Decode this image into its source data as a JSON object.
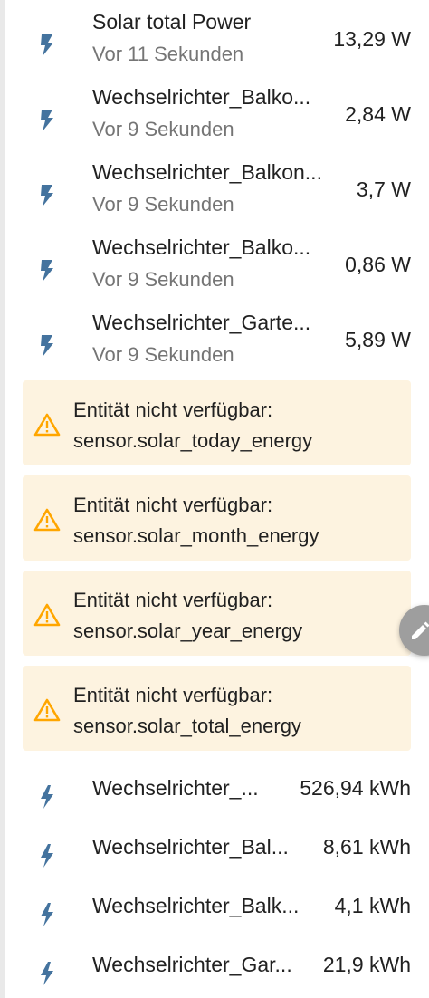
{
  "power_rows": [
    {
      "name": "Solar total Power",
      "updated": "Vor 11 Sekunden",
      "value": "13,29 W",
      "icon": "lightning-bolt-icon"
    },
    {
      "name": "Wechselrichter_Balko...",
      "updated": "Vor 9 Sekunden",
      "value": "2,84 W",
      "icon": "lightning-bolt-icon"
    },
    {
      "name": "Wechselrichter_Balkon...",
      "updated": "Vor 9 Sekunden",
      "value": "3,7 W",
      "icon": "lightning-bolt-icon"
    },
    {
      "name": "Wechselrichter_Balko...",
      "updated": "Vor 9 Sekunden",
      "value": "0,86 W",
      "icon": "lightning-bolt-icon"
    },
    {
      "name": "Wechselrichter_Garte...",
      "updated": "Vor 9 Sekunden",
      "value": "5,89 W",
      "icon": "lightning-bolt-icon"
    }
  ],
  "warnings": [
    {
      "title": "Entität nicht verfügbar:",
      "entity": "sensor.solar_today_energy",
      "icon": "warning-triangle-icon"
    },
    {
      "title": "Entität nicht verfügbar:",
      "entity": "sensor.solar_month_energy",
      "icon": "warning-triangle-icon"
    },
    {
      "title": "Entität nicht verfügbar:",
      "entity": "sensor.solar_year_energy",
      "icon": "warning-triangle-icon"
    },
    {
      "title": "Entität nicht verfügbar:",
      "entity": "sensor.solar_total_energy",
      "icon": "warning-triangle-icon"
    }
  ],
  "energy_rows": [
    {
      "name": "Wechselrichter_...",
      "value": "526,94 kWh",
      "icon": "lightning-bolt-icon"
    },
    {
      "name": "Wechselrichter_Bal...",
      "value": "8,61 kWh",
      "icon": "lightning-bolt-icon"
    },
    {
      "name": "Wechselrichter_Balk...",
      "value": "4,1 kWh",
      "icon": "lightning-bolt-icon"
    },
    {
      "name": "Wechselrichter_Gar...",
      "value": "21,9 kWh",
      "icon": "lightning-bolt-icon"
    }
  ],
  "fab": {
    "icon": "pencil-edit-icon"
  },
  "colors": {
    "icon_blue": "#44739e",
    "warning_orange": "#ffa600",
    "warning_bg": "#fdf3e0",
    "secondary_text": "#757575",
    "primary_text": "#212121"
  }
}
